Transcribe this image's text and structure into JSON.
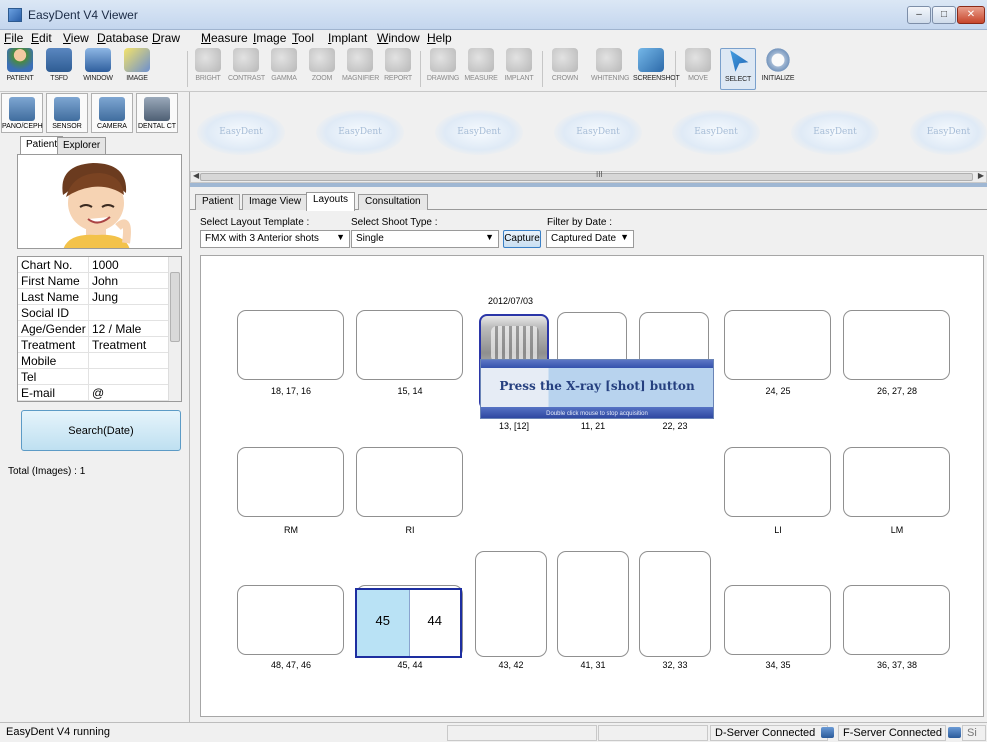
{
  "window": {
    "title": "EasyDent V4 Viewer"
  },
  "menu": [
    "File",
    "Edit",
    "View",
    "Database",
    "Draw",
    "Measure",
    "Image",
    "Tool",
    "Implant",
    "Window",
    "Help"
  ],
  "toolbar_left": [
    {
      "label": "PATIENT",
      "icon": "patient-icon"
    },
    {
      "label": "TSFD",
      "icon": "tsfd-icon"
    },
    {
      "label": "WINDOW",
      "icon": "window-icon"
    },
    {
      "label": "IMAGE",
      "icon": "image-icon"
    }
  ],
  "toolbar_right": [
    {
      "label": "BRIGHT",
      "icon": "bright-icon"
    },
    {
      "label": "CONTRAST",
      "icon": "contrast-icon"
    },
    {
      "label": "GAMMA",
      "icon": "gamma-icon"
    },
    {
      "label": "ZOOM",
      "icon": "zoom-icon"
    },
    {
      "label": "MAGNIFIER",
      "icon": "magnifier-icon"
    },
    {
      "label": "REPORT",
      "icon": "report-icon"
    },
    {
      "label": "DRAWING",
      "icon": "drawing-icon"
    },
    {
      "label": "MEASURE",
      "icon": "measure-icon"
    },
    {
      "label": "IMPLANT",
      "icon": "implant-icon"
    },
    {
      "label": "CROWN",
      "icon": "crown-icon"
    },
    {
      "label": "WHITENING",
      "icon": "whitening-icon"
    },
    {
      "label": "SCREENSHOT",
      "icon": "screenshot-icon"
    },
    {
      "label": "MOVE",
      "icon": "move-icon"
    },
    {
      "label": "SELECT",
      "icon": "select-icon"
    },
    {
      "label": "INITIALIZE",
      "icon": "initialize-icon"
    }
  ],
  "devices": [
    {
      "label": "PANO/CEPH",
      "icon": "pano-ceph-icon"
    },
    {
      "label": "SENSOR",
      "icon": "sensor-icon"
    },
    {
      "label": "CAMERA",
      "icon": "camera-icon"
    },
    {
      "label": "DENTAL CT",
      "icon": "dental-ct-icon"
    }
  ],
  "left_tabs": [
    "Patient",
    "Explorer"
  ],
  "patient": {
    "rows": [
      {
        "k": "Chart No.",
        "v": "1000"
      },
      {
        "k": "First Name",
        "v": "John"
      },
      {
        "k": "Last Name",
        "v": "Jung"
      },
      {
        "k": "Social ID",
        "v": ""
      },
      {
        "k": "Age/Gender",
        "v": "12 / Male"
      },
      {
        "k": "Treatment",
        "v": "Treatment"
      },
      {
        "k": "Mobile",
        "v": ""
      },
      {
        "k": "Tel",
        "v": ""
      },
      {
        "k": "E-mail",
        "v": "@"
      }
    ]
  },
  "search_button": "Search(Date)",
  "total_images": "Total (Images) : 1",
  "thumb_watermark": "EasyDent",
  "scroll_grip": "III",
  "main_tabs": [
    "Patient",
    "Image View",
    "Layouts",
    "Consultation"
  ],
  "filters": {
    "layout_label": "Select Layout Template :",
    "layout_value": "FMX with 3 Anterior shots",
    "shoot_label": "Select Shoot Type :",
    "shoot_value": "Single",
    "capture": "Capture",
    "date_label": "Filter by Date :",
    "date_value": "Captured Date"
  },
  "layout": {
    "date": "2012/07/03",
    "popup_message": "Press the X-ray [shot] button",
    "popup_sub": "Double click mouse to stop acquisition",
    "selected_left": "45",
    "selected_right": "44",
    "row1": [
      "18, 17, 16",
      "15, 14",
      "13, [12]",
      "11, 21",
      "22, 23",
      "24, 25",
      "26, 27, 28"
    ],
    "row2": [
      "RM",
      "RI",
      "LI",
      "LM"
    ],
    "row3": [
      "48, 47, 46",
      "45, 44",
      "43, 42",
      "41, 31",
      "32, 33",
      "34, 35",
      "36, 37, 38"
    ]
  },
  "status": {
    "running": "EasyDent V4 running",
    "dserver": "D-Server Connected",
    "fserver": "F-Server Connected",
    "tail": "Si"
  }
}
